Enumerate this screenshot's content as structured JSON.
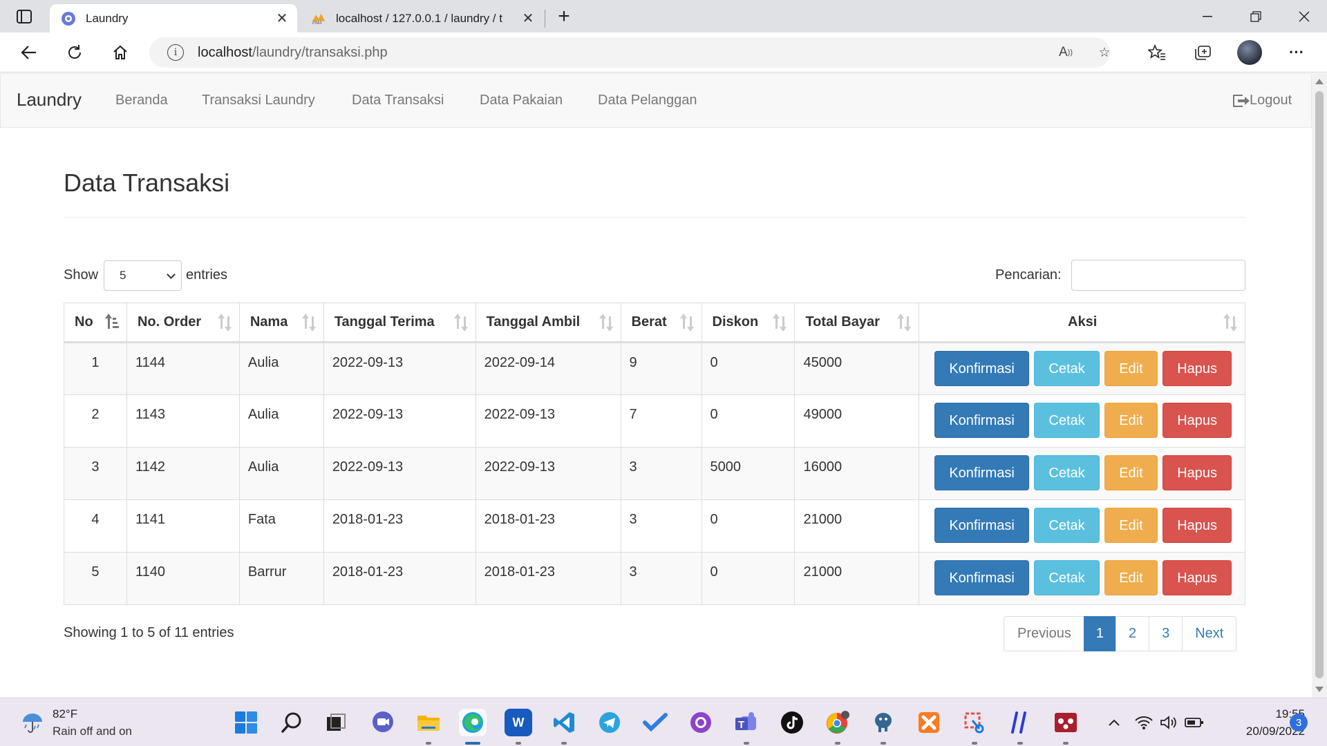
{
  "browser": {
    "tabs": [
      {
        "title": "Laundry",
        "icon": "laundry-favicon",
        "active": true
      },
      {
        "title": "localhost / 127.0.0.1 / laundry / t",
        "icon": "phpmyadmin-favicon",
        "active": false
      }
    ],
    "new_tab_glyph": "+",
    "address": {
      "host": "localhost",
      "path": "/laundry/transaksi.php"
    }
  },
  "navbar": {
    "brand": "Laundry",
    "links": [
      "Beranda",
      "Transaksi Laundry",
      "Data Transaksi",
      "Data Pakaian",
      "Data Pelanggan"
    ],
    "logout": "Logout"
  },
  "page": {
    "title": "Data Transaksi",
    "show_label": "Show",
    "entries_value": "5",
    "entries_label": "entries",
    "search_label": "Pencarian:",
    "search_value": ""
  },
  "table": {
    "columns": [
      "No",
      "No. Order",
      "Nama",
      "Tanggal Terima",
      "Tanggal Ambil",
      "Berat",
      "Diskon",
      "Total Bayar",
      "Aksi"
    ],
    "action_labels": {
      "confirm": "Konfirmasi",
      "print": "Cetak",
      "edit": "Edit",
      "delete": "Hapus"
    },
    "rows": [
      {
        "no": "1",
        "order": "1144",
        "nama": "Aulia",
        "terima": "2022-09-13",
        "ambil": "2022-09-14",
        "berat": "9",
        "diskon": "0",
        "total": "45000"
      },
      {
        "no": "2",
        "order": "1143",
        "nama": "Aulia",
        "terima": "2022-09-13",
        "ambil": "2022-09-13",
        "berat": "7",
        "diskon": "0",
        "total": "49000"
      },
      {
        "no": "3",
        "order": "1142",
        "nama": "Aulia",
        "terima": "2022-09-13",
        "ambil": "2022-09-13",
        "berat": "3",
        "diskon": "5000",
        "total": "16000"
      },
      {
        "no": "4",
        "order": "1141",
        "nama": "Fata",
        "terima": "2018-01-23",
        "ambil": "2018-01-23",
        "berat": "3",
        "diskon": "0",
        "total": "21000"
      },
      {
        "no": "5",
        "order": "1140",
        "nama": "Barrur",
        "terima": "2018-01-23",
        "ambil": "2018-01-23",
        "berat": "3",
        "diskon": "0",
        "total": "21000"
      }
    ]
  },
  "footer": {
    "info": "Showing 1 to 5 of 11 entries",
    "pagination": {
      "previous": "Previous",
      "pages": [
        "1",
        "2",
        "3"
      ],
      "current": "1",
      "next": "Next"
    }
  },
  "taskbar": {
    "weather": {
      "temp": "82°F",
      "desc": "Rain off and on"
    },
    "time": "19:55",
    "date": "20/09/2022",
    "notifications": "3",
    "apps": [
      "windows-start",
      "search",
      "task-view",
      "teams-chat",
      "file-explorer",
      "edge",
      "word",
      "vscode",
      "telegram",
      "todo",
      "github-desktop",
      "teams",
      "tiktok",
      "chrome",
      "postgresql",
      "xampp",
      "snipping",
      "notepad",
      "mendeley"
    ]
  },
  "colors": {
    "primary": "#337ab7",
    "info": "#5bc0de",
    "warning": "#f0ad4e",
    "danger": "#d9534f"
  }
}
